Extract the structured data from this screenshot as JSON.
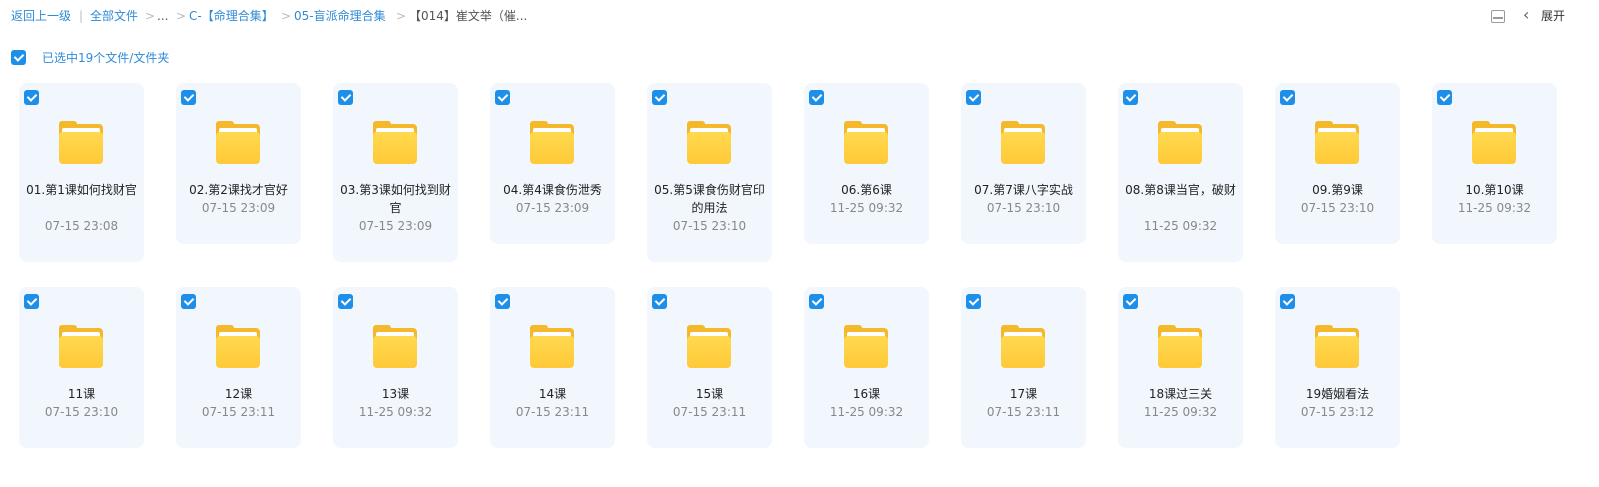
{
  "breadcrumb": {
    "back": "返回上一级",
    "sep1": "|",
    "all_files": "全部文件",
    "sep2": ">",
    "ellipsis": "...",
    "sep3": ">",
    "c1": "C-【命理合集】",
    "sep4": ">",
    "c2": "05-盲派命理合集",
    "sep5": ">",
    "current": "【014】崔文举（催..."
  },
  "toolbar": {
    "expand_label": "展开",
    "collapse_glyph": "‹"
  },
  "selection": {
    "label": "已选中19个文件/文件夹"
  },
  "folders": [
    {
      "name": "01.第1课如何找财官",
      "date": "07-15 23:08"
    },
    {
      "name": "02.第2课找才官好",
      "date": "07-15 23:09"
    },
    {
      "name": "03.第3课如何找到财官",
      "date": "07-15 23:09"
    },
    {
      "name": "04.第4课食伤泄秀",
      "date": "07-15 23:09"
    },
    {
      "name": "05.第5课食伤财官印的用法",
      "date": "07-15 23:10"
    },
    {
      "name": "06.第6课",
      "date": "11-25 09:32"
    },
    {
      "name": "07.第7课八字实战",
      "date": "07-15 23:10"
    },
    {
      "name": "08.第8课当官，破财",
      "date": "11-25 09:32"
    },
    {
      "name": "09.第9课",
      "date": "07-15 23:10"
    },
    {
      "name": "10.第10课",
      "date": "11-25 09:32"
    },
    {
      "name": "11课",
      "date": "07-15 23:10"
    },
    {
      "name": "12课",
      "date": "07-15 23:11"
    },
    {
      "name": "13课",
      "date": "11-25 09:32"
    },
    {
      "name": "14课",
      "date": "07-15 23:11"
    },
    {
      "name": "15课",
      "date": "07-15 23:11"
    },
    {
      "name": "16课",
      "date": "11-25 09:32"
    },
    {
      "name": "17课",
      "date": "07-15 23:11"
    },
    {
      "name": "18课过三关",
      "date": "11-25 09:32"
    },
    {
      "name": "19婚姻看法",
      "date": "07-15 23:12"
    }
  ],
  "colors": {
    "accent": "#1e8fe8",
    "card_bg": "#f1f7fd",
    "folder": "#ffc938"
  }
}
